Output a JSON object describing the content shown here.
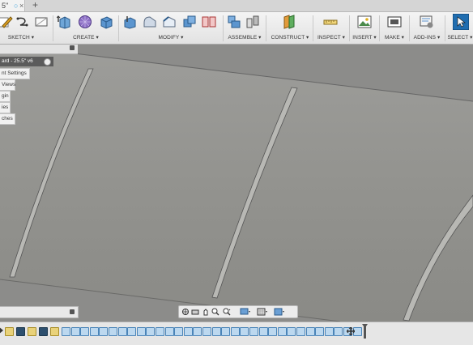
{
  "tab": {
    "title": "5\"",
    "close": "×",
    "new": "+"
  },
  "toolbar": {
    "groups": [
      {
        "id": "sketch",
        "label": "SKETCH ▾"
      },
      {
        "id": "create",
        "label": "CREATE ▾"
      },
      {
        "id": "modify",
        "label": "MODIFY ▾"
      },
      {
        "id": "assemble",
        "label": "ASSEMBLE ▾"
      },
      {
        "id": "construct",
        "label": "CONSTRUCT ▾"
      },
      {
        "id": "inspect",
        "label": "INSPECT ▾"
      },
      {
        "id": "insert",
        "label": "INSERT ▾"
      },
      {
        "id": "make",
        "label": "MAKE ▾"
      },
      {
        "id": "addins",
        "label": "ADD-INS ▾"
      },
      {
        "id": "select",
        "label": "SELECT ▾"
      }
    ]
  },
  "browser": {
    "title": "ard - 25.5\" v6",
    "items": [
      "nt Settings",
      "Views",
      "gin",
      "ies",
      "ches"
    ]
  },
  "colors": {
    "accent": "#1f6db0",
    "body_fill": "#8f8f8c",
    "toolbar_bg": "#ececec"
  },
  "timeline": {
    "items": [
      "sketch",
      "sketch",
      "sketch",
      "sketch",
      "sketch",
      "feature",
      "feature",
      "feature",
      "feature",
      "feature",
      "feature",
      "feature",
      "feature",
      "feature",
      "feature",
      "feature",
      "feature",
      "feature",
      "feature",
      "feature",
      "feature",
      "feature",
      "feature",
      "feature",
      "feature",
      "feature",
      "feature",
      "feature",
      "feature",
      "feature",
      "feature",
      "feature",
      "feature",
      "feature",
      "feature",
      "feature",
      "feature",
      "move",
      "marker"
    ]
  }
}
